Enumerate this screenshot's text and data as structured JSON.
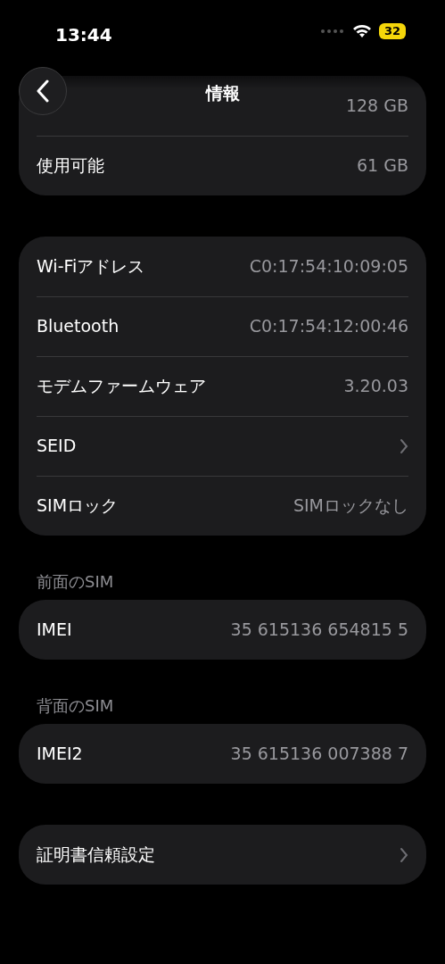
{
  "status_bar": {
    "time": "13:44",
    "battery": "32"
  },
  "nav": {
    "title": "情報"
  },
  "groups": [
    {
      "rows": [
        {
          "value": "128 GB"
        },
        {
          "label": "使用可能",
          "value": "61 GB"
        }
      ]
    },
    {
      "rows": [
        {
          "label": "Wi-Fiアドレス",
          "value": "C0:17:54:10:09:05"
        },
        {
          "label": "Bluetooth",
          "value": "C0:17:54:12:00:46"
        },
        {
          "label": "モデムファームウェア",
          "value": "3.20.03"
        },
        {
          "label": "SEID",
          "kind": "chevron"
        },
        {
          "label": "SIMロック",
          "value": "SIMロックなし"
        }
      ]
    },
    {
      "header": "前面のSIM",
      "rows": [
        {
          "label": "IMEI",
          "value": "35 615136 654815 5"
        }
      ]
    },
    {
      "header": "背面のSIM",
      "rows": [
        {
          "label": "IMEI2",
          "value": "35 615136 007388 7"
        }
      ]
    },
    {
      "rows": [
        {
          "label": "証明書信頼設定",
          "kind": "chevron"
        }
      ]
    }
  ]
}
